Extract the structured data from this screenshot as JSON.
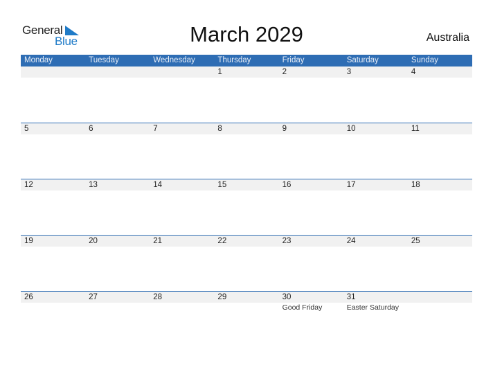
{
  "logo": {
    "line1": "General",
    "line2": "Blue",
    "accent_color": "#1f7bc8"
  },
  "title": "March 2029",
  "country": "Australia",
  "header_color": "#2e6db4",
  "days": [
    "Monday",
    "Tuesday",
    "Wednesday",
    "Thursday",
    "Friday",
    "Saturday",
    "Sunday"
  ],
  "weeks": [
    {
      "dates": [
        "",
        "",
        "",
        "1",
        "2",
        "3",
        "4"
      ],
      "events": [
        "",
        "",
        "",
        "",
        "",
        "",
        ""
      ]
    },
    {
      "dates": [
        "5",
        "6",
        "7",
        "8",
        "9",
        "10",
        "11"
      ],
      "events": [
        "",
        "",
        "",
        "",
        "",
        "",
        ""
      ]
    },
    {
      "dates": [
        "12",
        "13",
        "14",
        "15",
        "16",
        "17",
        "18"
      ],
      "events": [
        "",
        "",
        "",
        "",
        "",
        "",
        ""
      ]
    },
    {
      "dates": [
        "19",
        "20",
        "21",
        "22",
        "23",
        "24",
        "25"
      ],
      "events": [
        "",
        "",
        "",
        "",
        "",
        "",
        ""
      ]
    },
    {
      "dates": [
        "26",
        "27",
        "28",
        "29",
        "30",
        "31",
        ""
      ],
      "events": [
        "",
        "",
        "",
        "",
        "Good Friday",
        "Easter Saturday",
        ""
      ]
    }
  ]
}
